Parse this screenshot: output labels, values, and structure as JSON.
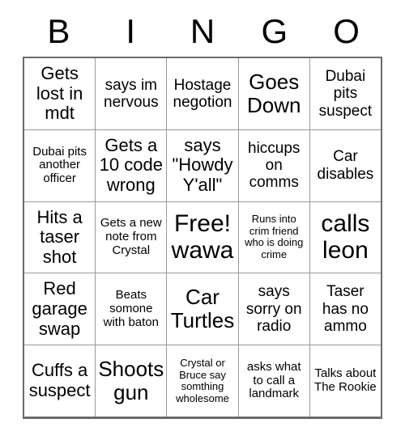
{
  "card": {
    "title": "BINGO",
    "header_letters": [
      "B",
      "I",
      "N",
      "G",
      "O"
    ],
    "colors": {
      "background": "#ffffff",
      "text": "#000000",
      "grid_border": "#6b6b6b",
      "cell_border": "#9a9a9a"
    },
    "rows": [
      [
        {
          "text": "Gets lost in mdt",
          "size": "lg"
        },
        {
          "text": "says im nervous",
          "size": "md"
        },
        {
          "text": "Hostage negotion",
          "size": "md"
        },
        {
          "text": "Goes Down",
          "size": "xl"
        },
        {
          "text": "Dubai pits suspect",
          "size": "md"
        }
      ],
      [
        {
          "text": "Dubai pits another officer",
          "size": "sm"
        },
        {
          "text": "Gets a 10 code wrong",
          "size": "lg"
        },
        {
          "text": "says \"Howdy Y'all\"",
          "size": "lg"
        },
        {
          "text": "hiccups on comms",
          "size": "md"
        },
        {
          "text": "Car disables",
          "size": "md"
        }
      ],
      [
        {
          "text": "Hits a taser shot",
          "size": "lg"
        },
        {
          "text": "Gets a new note from Crystal",
          "size": "sm"
        },
        {
          "text": "Free! wawa",
          "size": "xxl"
        },
        {
          "text": "Runs into crim friend who is doing crime",
          "size": "xs"
        },
        {
          "text": "calls leon",
          "size": "xxl"
        }
      ],
      [
        {
          "text": "Red garage swap",
          "size": "lg"
        },
        {
          "text": "Beats somone with baton",
          "size": "sm"
        },
        {
          "text": "Car Turtles",
          "size": "xl"
        },
        {
          "text": "says sorry on radio",
          "size": "md"
        },
        {
          "text": "Taser has no ammo",
          "size": "md"
        }
      ],
      [
        {
          "text": "Cuffs a suspect",
          "size": "lg"
        },
        {
          "text": "Shoots gun",
          "size": "xl"
        },
        {
          "text": "Crystal or Bruce say somthing wholesome",
          "size": "xs"
        },
        {
          "text": "asks what to call a landmark",
          "size": "sm"
        },
        {
          "text": "Talks about The Rookie",
          "size": "sm"
        }
      ]
    ]
  }
}
